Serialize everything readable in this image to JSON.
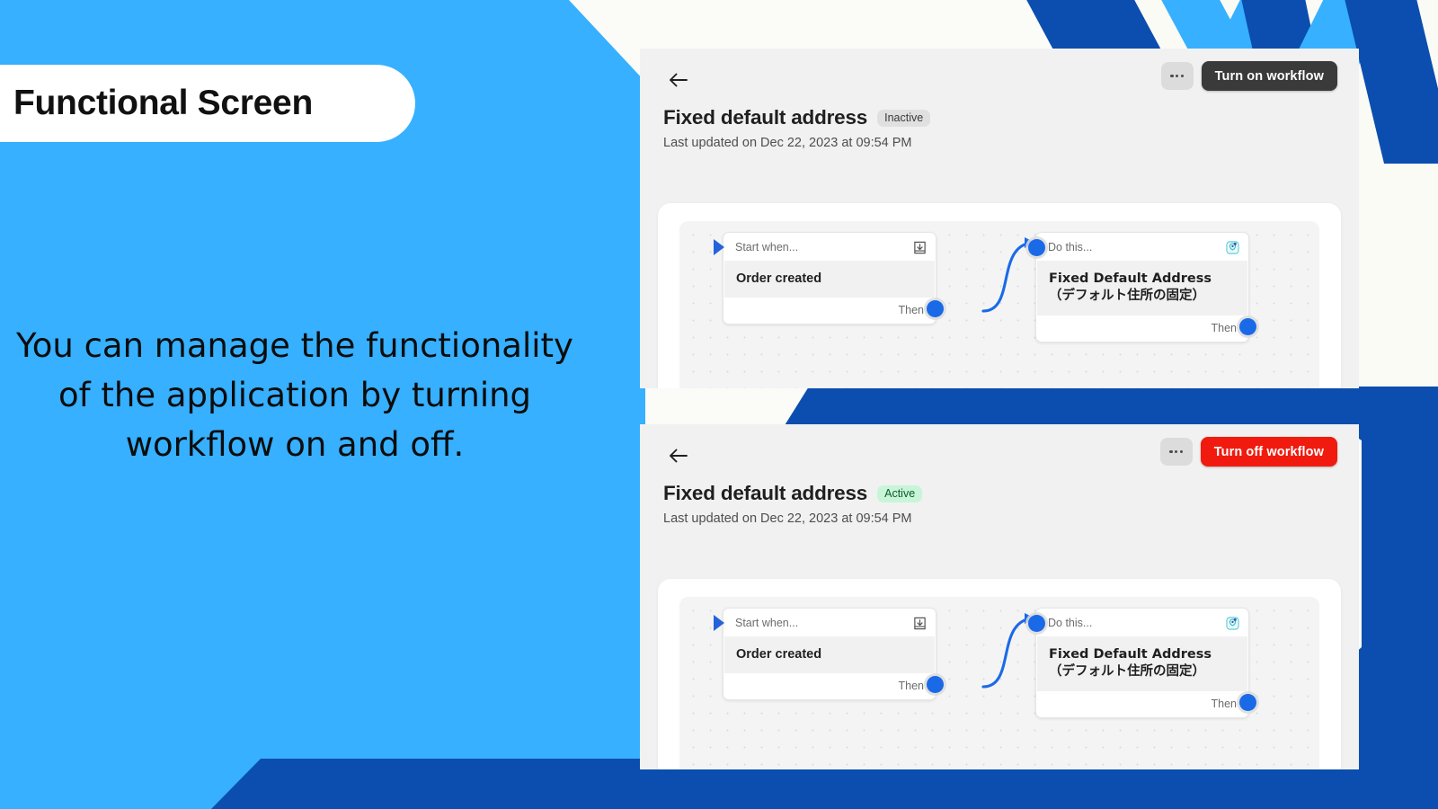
{
  "slide": {
    "title": "Functional Screen",
    "body_text": "You can manage the functionality of the application by turning workflow on and off.",
    "colors": {
      "light_blue": "#36B0FF",
      "dark_blue": "#0B4EAF",
      "off_white": "#FBFBF6",
      "panel_bg": "#F1F1F1",
      "btn_dark": "#3A3A3A",
      "btn_red": "#F01B0E",
      "badge_active_bg": "#C8F5D8",
      "badge_inactive_bg": "#E0E0E0",
      "node_blue": "#1A6AE8"
    }
  },
  "panels": [
    {
      "id": "inactive-workflow",
      "back_icon": "back-arrow-icon",
      "overflow_icon": "ellipsis-icon",
      "action_button": "Turn on workflow",
      "action_button_style": "dark",
      "title": "Fixed default address",
      "status": "Inactive",
      "status_style": "inactive",
      "last_updated": "Last updated on Dec 22, 2023 at 09:54 PM",
      "nodes": [
        {
          "header": "Start when...",
          "header_icon": "inbox-download-icon",
          "body": "Order created",
          "footer": "Then"
        },
        {
          "header": "Do this...",
          "header_icon": "app-shield-icon",
          "body": "Fixed Default Address （デフォルト住所の固定）",
          "footer": "Then"
        }
      ]
    },
    {
      "id": "active-workflow",
      "back_icon": "back-arrow-icon",
      "overflow_icon": "ellipsis-icon",
      "action_button": "Turn off workflow",
      "action_button_style": "red",
      "title": "Fixed default address",
      "status": "Active",
      "status_style": "active",
      "last_updated": "Last updated on Dec 22, 2023 at 09:54 PM",
      "nodes": [
        {
          "header": "Start when...",
          "header_icon": "inbox-download-icon",
          "body": "Order created",
          "footer": "Then"
        },
        {
          "header": "Do this...",
          "header_icon": "app-shield-icon",
          "body": "Fixed Default Address （デフォルト住所の固定）",
          "footer": "Then"
        }
      ]
    }
  ]
}
